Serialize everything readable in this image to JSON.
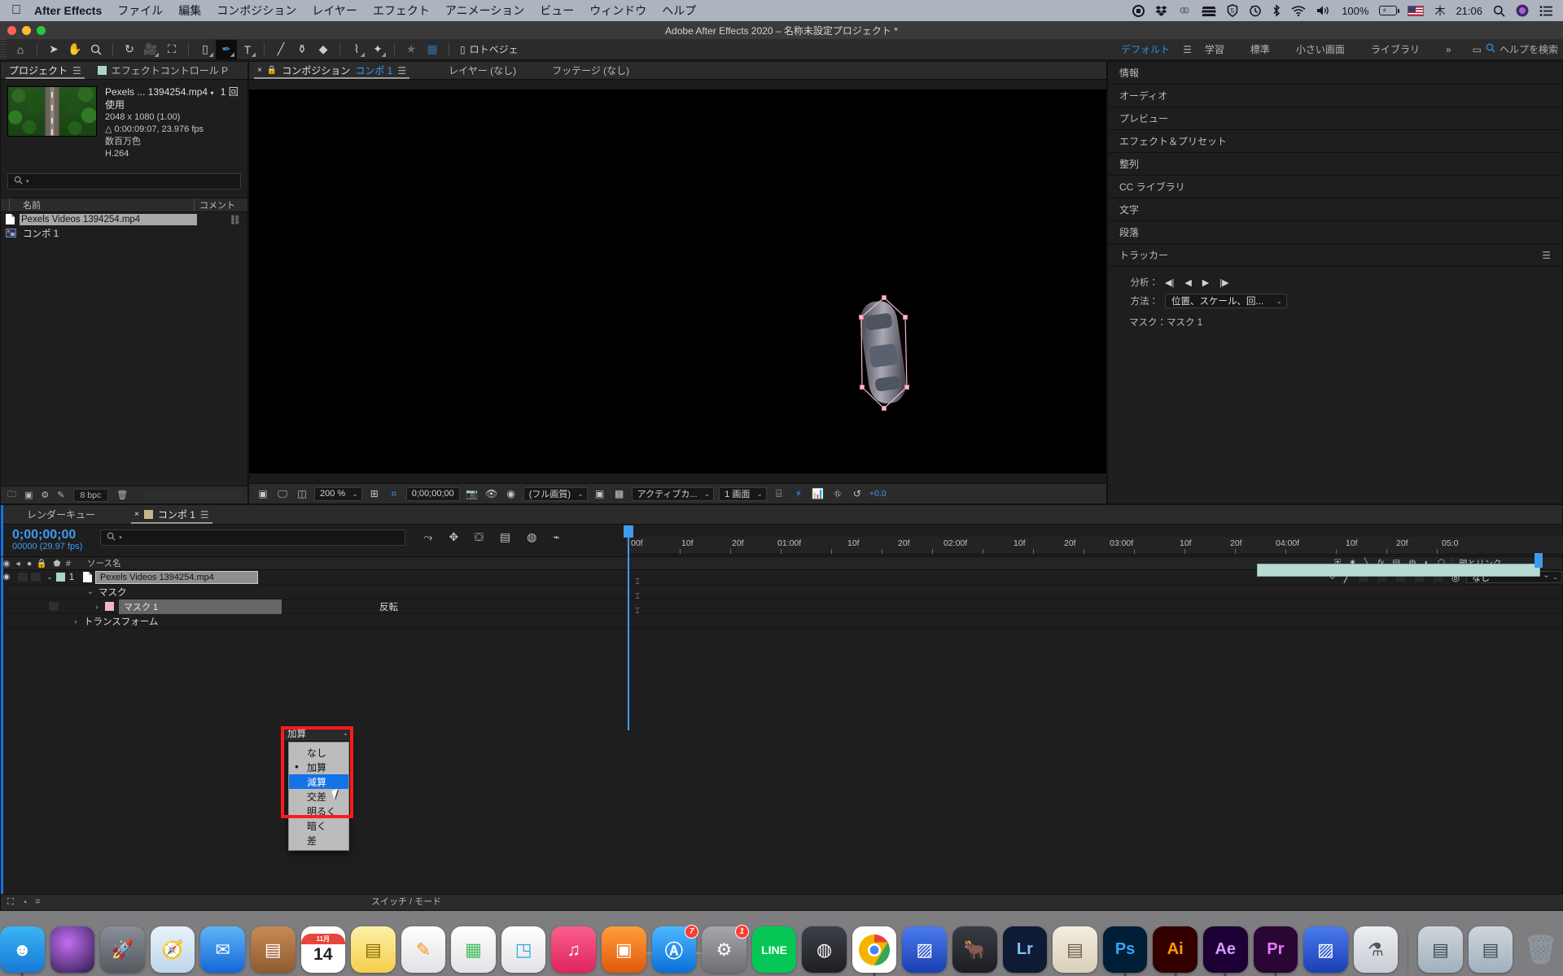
{
  "mac_menu": {
    "app_name": "After Effects",
    "items": [
      "ファイル",
      "編集",
      "コンポジション",
      "レイヤー",
      "エフェクト",
      "アニメーション",
      "ビュー",
      "ウィンドウ",
      "ヘルプ"
    ],
    "status_icons": [
      "record-icon",
      "dropbox-icon",
      "creative-cloud-icon",
      "backup-icon",
      "sophos-icon",
      "timemachine-icon",
      "bluetooth-icon",
      "wifi-icon",
      "volume-icon"
    ],
    "battery_percent": "100%",
    "input_source": "us-flag-icon",
    "day": "木",
    "time": "21:06",
    "spotlight": "search-icon",
    "siri": "siri-icon",
    "control_center": "list-icon"
  },
  "window": {
    "title": "Adobe After Effects 2020 – 名称未設定プロジェクト *"
  },
  "toolbar": {
    "tools": [
      {
        "name": "home-icon",
        "glyph": "⌂",
        "selected": false
      },
      {
        "name": "selection-tool",
        "glyph": "➤",
        "selected": false
      },
      {
        "name": "hand-tool",
        "glyph": "✋",
        "selected": false
      },
      {
        "name": "zoom-tool",
        "glyph": "🔍",
        "selected": false
      },
      {
        "name": "rotation-tool",
        "glyph": "↻",
        "selected": false
      },
      {
        "name": "camera-tool",
        "glyph": "🎥",
        "selected": false
      },
      {
        "name": "pan-behind-tool",
        "glyph": "⌗",
        "selected": false
      },
      {
        "name": "shape-tool",
        "glyph": "▢",
        "selected": false
      },
      {
        "name": "pen-tool",
        "glyph": "✒",
        "selected": true
      },
      {
        "name": "type-tool",
        "glyph": "T",
        "selected": false
      },
      {
        "name": "brush-tool",
        "glyph": "🖌",
        "selected": false
      },
      {
        "name": "clone-stamp-tool",
        "glyph": "⚲",
        "selected": false
      },
      {
        "name": "eraser-tool",
        "glyph": "◆",
        "selected": false
      },
      {
        "name": "roto-brush-tool",
        "glyph": "⌇",
        "selected": false
      },
      {
        "name": "puppet-tool",
        "glyph": "✦",
        "selected": false
      }
    ],
    "star_icon": "★",
    "mask_icon": "mask-icon",
    "roto_bezier_label": "ロトベジェ",
    "workspaces": [
      {
        "label": "デフォルト",
        "active": true
      },
      {
        "label": "学習",
        "active": false
      },
      {
        "label": "標準",
        "active": false
      },
      {
        "label": "小さい画面",
        "active": false
      },
      {
        "label": "ライブラリ",
        "active": false
      }
    ],
    "overflow": "»",
    "screen_icon": "screen-icon",
    "help_search_placeholder": "ヘルプを検索"
  },
  "project_panel": {
    "tabs": [
      {
        "label": "プロジェクト",
        "active": true,
        "icon": null
      },
      {
        "label": "エフェクトコントロール P",
        "active": false,
        "icon": "comp-swatch"
      }
    ],
    "selected_asset": {
      "name": "Pexels ... 1394254.mp4",
      "usage": "1 回使用",
      "dimensions": "2048 x 1080 (1.00)",
      "duration": "0:00:09:07, 23.976 fps",
      "color_depth": "数百万色",
      "codec": "H.264"
    },
    "search_placeholder": "",
    "columns": [
      "名前",
      "コメント"
    ],
    "items": [
      {
        "name": "Pexels Videos 1394254.mp4",
        "type": "footage",
        "selected": true
      },
      {
        "name": "コンポ 1",
        "type": "composition",
        "selected": false
      }
    ],
    "footer": {
      "bit_depth": "8 bpc"
    }
  },
  "comp_panel": {
    "tabs": [
      {
        "label": "コンポジション",
        "sub": "コンポ 1",
        "active": true
      },
      {
        "label": "レイヤー (なし)",
        "active": false
      },
      {
        "label": "フッテージ (なし)",
        "active": false
      }
    ],
    "comp_tab_chip": "コンポ 1",
    "footer": {
      "zoom": "200 %",
      "time": "0;00;00;00",
      "quality": "(フル画質)",
      "view": "アクティブカ...",
      "views": "1 画面",
      "exposure": "+0.0"
    }
  },
  "sidebar": {
    "panels": [
      {
        "label": "情報"
      },
      {
        "label": "オーディオ"
      },
      {
        "label": "プレビュー"
      },
      {
        "label": "エフェクト＆プリセット"
      },
      {
        "label": "整列"
      },
      {
        "label": "CC ライブラリ"
      },
      {
        "label": "文字"
      },
      {
        "label": "段落"
      }
    ],
    "tracker": {
      "title": "トラッカー",
      "analyze_label": "分析：",
      "analyze_buttons": [
        "analyze-back-1-frame-icon",
        "analyze-backward-icon",
        "analyze-forward-icon",
        "analyze-forward-1-frame-icon"
      ],
      "method_label": "方法：",
      "method_value": "位置、スケール、回...",
      "mask_label": "マスク：マスク 1"
    }
  },
  "timeline": {
    "tabs": [
      {
        "label": "レンダーキュー",
        "active": false
      },
      {
        "label": "コンポ 1",
        "active": true
      }
    ],
    "current_time": "0;00;00;00",
    "frame_info": "00000 (29.97 fps)",
    "search_placeholder": "",
    "columns": {
      "hash": "#",
      "source": "ソース名",
      "parent": "親とリンク"
    },
    "switch_icons": [
      "shy-icon",
      "motion-blur-icon",
      "draft-3d-icon",
      "fx-icon",
      "frame-blend-icon",
      "motion-blur-layer-icon",
      "adjustment-icon",
      "3d-layer-icon"
    ],
    "layers": [
      {
        "index": "1",
        "name": "Pexels Videos 1394254.mp4",
        "parent": "なし",
        "selected": true
      }
    ],
    "groups": [
      {
        "label": "マスク",
        "depth": 1
      },
      {
        "label": "マスク 1",
        "depth": 2,
        "mode": "加算",
        "invert_label": "反転"
      },
      {
        "label": "トランスフォーム",
        "depth": 1
      }
    ],
    "ruler_ticks": [
      "00f",
      "10f",
      "20f",
      "01:00f",
      "10f",
      "20f",
      "02:00f",
      "10f",
      "20f",
      "03:00f",
      "10f",
      "20f",
      "04:00f",
      "10f",
      "20f",
      "05:0"
    ],
    "footer_label": "スイッチ / モード"
  },
  "mask_mode_dropdown": {
    "current": "加算",
    "options": [
      {
        "label": "なし",
        "checked": false,
        "highlighted": false
      },
      {
        "label": "加算",
        "checked": true,
        "highlighted": false
      },
      {
        "label": "減算",
        "checked": false,
        "highlighted": true
      },
      {
        "label": "交差",
        "checked": false,
        "highlighted": false
      },
      {
        "label": "明るく",
        "checked": false,
        "highlighted": false
      },
      {
        "label": "暗く",
        "checked": false,
        "highlighted": false
      },
      {
        "label": "差",
        "checked": false,
        "highlighted": false
      }
    ],
    "highlight_color": "#ff1b1b",
    "selection_color": "#1473e6"
  },
  "dock": {
    "apps": [
      {
        "name": "finder",
        "label": "☺",
        "color": "#1e8fe0",
        "badge": null,
        "running": true
      },
      {
        "name": "siri",
        "label": "◉",
        "color": "#2b1a4a",
        "badge": null,
        "running": false
      },
      {
        "name": "launchpad",
        "label": "🚀",
        "color": "#5c5f66",
        "badge": null,
        "running": false
      },
      {
        "name": "safari",
        "label": "🧭",
        "color": "#1b8ff0",
        "badge": null,
        "running": false
      },
      {
        "name": "mail",
        "label": "✉",
        "color": "#1f7ff0",
        "badge": null,
        "running": false
      },
      {
        "name": "contacts",
        "label": "▤",
        "color": "#b5764a",
        "badge": null,
        "running": false
      },
      {
        "name": "calendar",
        "label": "14",
        "color": "#ffffff",
        "badge": null,
        "running": false
      },
      {
        "name": "notes",
        "label": "▤",
        "color": "#fde06a",
        "badge": null,
        "running": false
      },
      {
        "name": "pages",
        "label": "✎",
        "color": "#f0a030",
        "badge": null,
        "running": false
      },
      {
        "name": "numbers",
        "label": "▦",
        "color": "#3fc060",
        "badge": null,
        "running": false
      },
      {
        "name": "keynote",
        "label": "◳",
        "color": "#2fa8e0",
        "badge": null,
        "running": false
      },
      {
        "name": "music",
        "label": "♫",
        "color": "#f0457a",
        "badge": null,
        "running": false
      },
      {
        "name": "books",
        "label": "▣",
        "color": "#f08030",
        "badge": null,
        "running": false
      },
      {
        "name": "app-store",
        "label": "Ⓐ",
        "color": "#1b8ff0",
        "badge": "7",
        "running": false
      },
      {
        "name": "system-preferences",
        "label": "⚙",
        "color": "#8a8a90",
        "badge": "1",
        "running": false
      },
      {
        "name": "line",
        "label": "LINE",
        "color": "#06c755",
        "badge": null,
        "running": false
      },
      {
        "name": "alfred",
        "label": "◍",
        "color": "#2b2b33",
        "badge": null,
        "running": false
      },
      {
        "name": "chrome",
        "label": "◉",
        "color": "#ffffff",
        "badge": null,
        "running": true
      },
      {
        "name": "unknown-blue",
        "label": "▨",
        "color": "#2f5fd0",
        "badge": null,
        "running": false
      },
      {
        "name": "handbrake",
        "label": "🐂",
        "color": "#2a2a30",
        "badge": null,
        "running": false
      },
      {
        "name": "lightroom",
        "label": "Lr",
        "color": "#0f1a35",
        "badge": null,
        "running": false
      },
      {
        "name": "notebook",
        "label": "▤",
        "color": "#e8e2d0",
        "badge": null,
        "running": false
      },
      {
        "name": "photoshop",
        "label": "Ps",
        "color": "#001e36",
        "badge": null,
        "running": true
      },
      {
        "name": "illustrator",
        "label": "Ai",
        "color": "#330000",
        "badge": null,
        "running": true
      },
      {
        "name": "after-effects",
        "label": "Ae",
        "color": "#1d0035",
        "badge": null,
        "running": true
      },
      {
        "name": "premiere-pro",
        "label": "Pr",
        "color": "#2a0634",
        "badge": null,
        "running": true
      },
      {
        "name": "media-encoder",
        "label": "▨",
        "color": "#2f5fd0",
        "badge": null,
        "running": false
      },
      {
        "name": "downloads-tool",
        "label": "⚗",
        "color": "#d8d8dc",
        "badge": null,
        "running": false
      },
      {
        "name": "photos-folder",
        "label": "▤",
        "color": "#cfd4d8",
        "badge": null,
        "running": false
      },
      {
        "name": "photos-folder-2",
        "label": "▤",
        "color": "#cfd4d8",
        "badge": null,
        "running": false
      },
      {
        "name": "trash",
        "label": "🗑",
        "color": "#b9bec4",
        "badge": null,
        "running": false
      }
    ]
  }
}
